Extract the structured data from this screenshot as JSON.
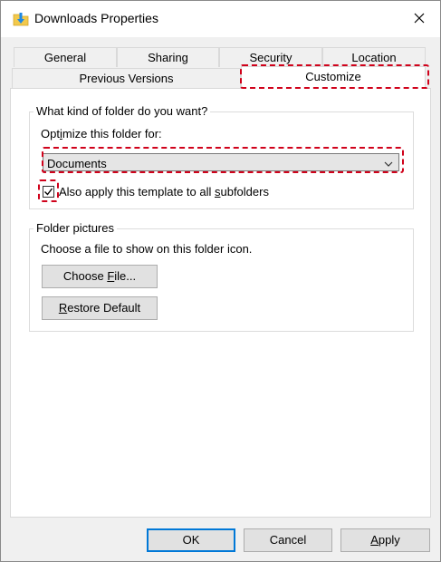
{
  "window": {
    "title": "Downloads Properties"
  },
  "tabs": {
    "row1": [
      "General",
      "Sharing",
      "Security",
      "Location"
    ],
    "row2": [
      "Previous Versions",
      "Customize"
    ],
    "active": "Customize"
  },
  "folder_type": {
    "group_title": "What kind of folder do you want?",
    "optimize_label_pre": "Opt",
    "optimize_label_mnemonic": "i",
    "optimize_label_post": "mize this folder for:",
    "selected_value": "Documents",
    "apply_checkbox_checked": true,
    "apply_label_pre": "Also apply this template to all ",
    "apply_label_mnemonic": "s",
    "apply_label_post": "ubfolders"
  },
  "folder_pictures": {
    "group_title": "Folder pictures",
    "description": "Choose a file to show on this folder icon.",
    "choose_file_pre": "Choose ",
    "choose_file_mnemonic": "F",
    "choose_file_post": "ile...",
    "restore_mnemonic": "R",
    "restore_post": "estore Default"
  },
  "footer": {
    "ok_label": "OK",
    "cancel_label": "Cancel",
    "apply_mnemonic": "A",
    "apply_post": "pply"
  },
  "colors": {
    "highlight": "#d0021b",
    "default_button_border": "#0078d7",
    "folder_yellow": "#f2c94c",
    "arrow_blue": "#1e88e5"
  },
  "icons": {
    "title_icon": "downloads-folder-icon",
    "close": "close-icon",
    "dropdown": "chevron-down-icon",
    "check": "checkmark-icon"
  }
}
